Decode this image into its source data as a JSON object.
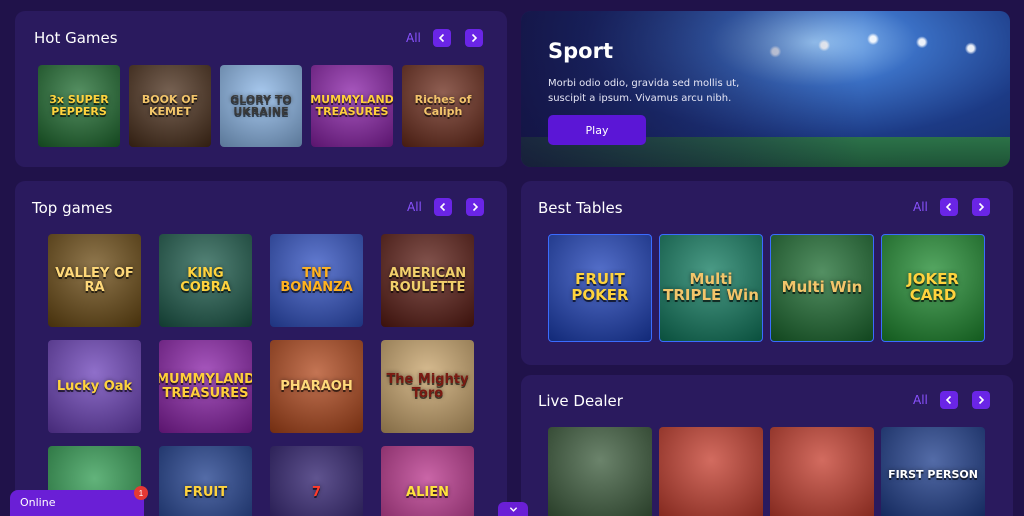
{
  "hot_games": {
    "title": "Hot Games",
    "all_label": "All",
    "tiles": [
      {
        "name": "3x SUPER PEPPERS",
        "bg": "#1d6b2e",
        "color": "#ffd33d"
      },
      {
        "name": "BOOK OF KEMET",
        "bg": "#4a2e1a",
        "color": "#f2c56a"
      },
      {
        "name": "GLORY TO UKRAINE",
        "bg": "#8ab6e8",
        "color": "#3a3a3a"
      },
      {
        "name": "MUMMYLAND TREASURES",
        "bg": "#8a1fa8",
        "color": "#ffcf3a"
      },
      {
        "name": "Riches of Caliph",
        "bg": "#6b2a1a",
        "color": "#f3c46b"
      }
    ]
  },
  "sport": {
    "title": "Sport",
    "text": "Morbi odio odio, gravida sed mollis ut, suscipit a ipsum. Vivamus arcu nibh.",
    "play_label": "Play"
  },
  "top_games": {
    "title": "Top games",
    "all_label": "All",
    "tiles": [
      {
        "name": "VALLEY OF RA",
        "bg": "#6b4a12",
        "color": "#ffd97a"
      },
      {
        "name": "KING COBRA",
        "bg": "#1b5a4a",
        "color": "#ffd33d"
      },
      {
        "name": "TNT BONANZA",
        "bg": "#2e4fc2",
        "color": "#ffb21f"
      },
      {
        "name": "AMERICAN ROULETTE",
        "bg": "#5a1a12",
        "color": "#f2d06b"
      },
      {
        "name": "Lucky Oak",
        "bg": "#6a3fb8",
        "color": "#ffd33d"
      },
      {
        "name": "MUMMYLAND TREASURES",
        "bg": "#8a1fa8",
        "color": "#ffcf3a"
      },
      {
        "name": "PHARAOH",
        "bg": "#b0461a",
        "color": "#ffd97a"
      },
      {
        "name": "The Mighty Toro",
        "bg": "#c9a46a",
        "color": "#7a1a12"
      },
      {
        "name": "",
        "bg": "#2e9a4f",
        "color": "#ffffff"
      },
      {
        "name": "FRUIT",
        "bg": "#1a3a8a",
        "color": "#ffd33d"
      },
      {
        "name": "7",
        "bg": "#2a1a6a",
        "color": "#ff3a2a"
      },
      {
        "name": "ALIEN",
        "bg": "#b8328a",
        "color": "#ffe33d"
      }
    ]
  },
  "best_tables": {
    "title": "Best Tables",
    "all_label": "All",
    "tiles": [
      {
        "name": "FRUIT POKER",
        "bg": "#1b3fb8",
        "color": "#ffd33d"
      },
      {
        "name": "Multi TRIPLE Win",
        "bg": "#0f7a5e",
        "color": "#f2c56a"
      },
      {
        "name": "Multi Win",
        "bg": "#1a6a2e",
        "color": "#f2c56a"
      },
      {
        "name": "JOKER CARD",
        "bg": "#1d8a2e",
        "color": "#ffd33d"
      }
    ]
  },
  "live_dealer": {
    "title": "Live Dealer",
    "all_label": "All",
    "tiles": [
      {
        "name": "",
        "bg": "#3a5a3a",
        "color": "#ffffff"
      },
      {
        "name": "",
        "bg": "#c43a2a",
        "color": "#ffffff"
      },
      {
        "name": "",
        "bg": "#c43a2a",
        "color": "#ffffff"
      },
      {
        "name": "FIRST PERSON",
        "bg": "#1a3a8a",
        "color": "#ffffff"
      }
    ]
  },
  "chat": {
    "label": "Online",
    "badge": "1"
  },
  "colors": {
    "background": "#20124a",
    "panel": "#2a1a5e",
    "accent": "#6a25e6",
    "all_link": "#8a52ff"
  }
}
